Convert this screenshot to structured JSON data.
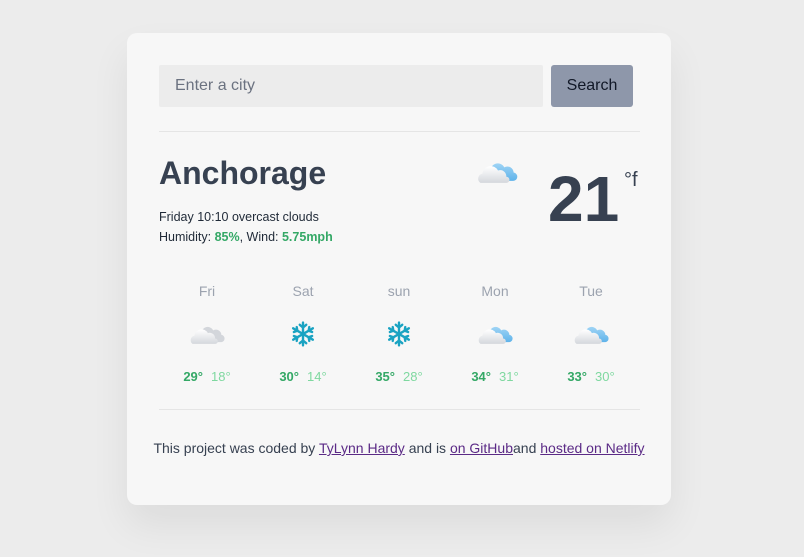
{
  "search": {
    "placeholder": "Enter a city",
    "button_label": "Search"
  },
  "current": {
    "city": "Anchorage",
    "day_time": "Friday 10:10",
    "description": "overcast clouds",
    "humidity_label": "Humidity: ",
    "humidity": "85%",
    "wind_label": ", Wind: ",
    "wind": "5.75mph",
    "temperature": "21",
    "unit": "°f",
    "icon": "cloud-icon"
  },
  "forecast": [
    {
      "day": "Fri",
      "icon": "cloud-gray-icon",
      "high": "29°",
      "low": "18°"
    },
    {
      "day": "Sat",
      "icon": "snowflake-icon",
      "high": "30°",
      "low": "14°"
    },
    {
      "day": "sun",
      "icon": "snowflake-icon",
      "high": "35°",
      "low": "28°"
    },
    {
      "day": "Mon",
      "icon": "cloud-icon",
      "high": "34°",
      "low": "31°"
    },
    {
      "day": "Tue",
      "icon": "cloud-icon",
      "high": "33°",
      "low": "30°"
    }
  ],
  "footer": {
    "text1": "This project was coded by ",
    "author": "TyLynn Hardy",
    "text2": " and is ",
    "github": "on GitHub",
    "text3": "and ",
    "netlify": "hosted on Netlify"
  },
  "colors": {
    "accent": "#34a866",
    "accent_light": "#7fd8a0",
    "button": "#8e97aa",
    "link": "#5b2a86"
  }
}
